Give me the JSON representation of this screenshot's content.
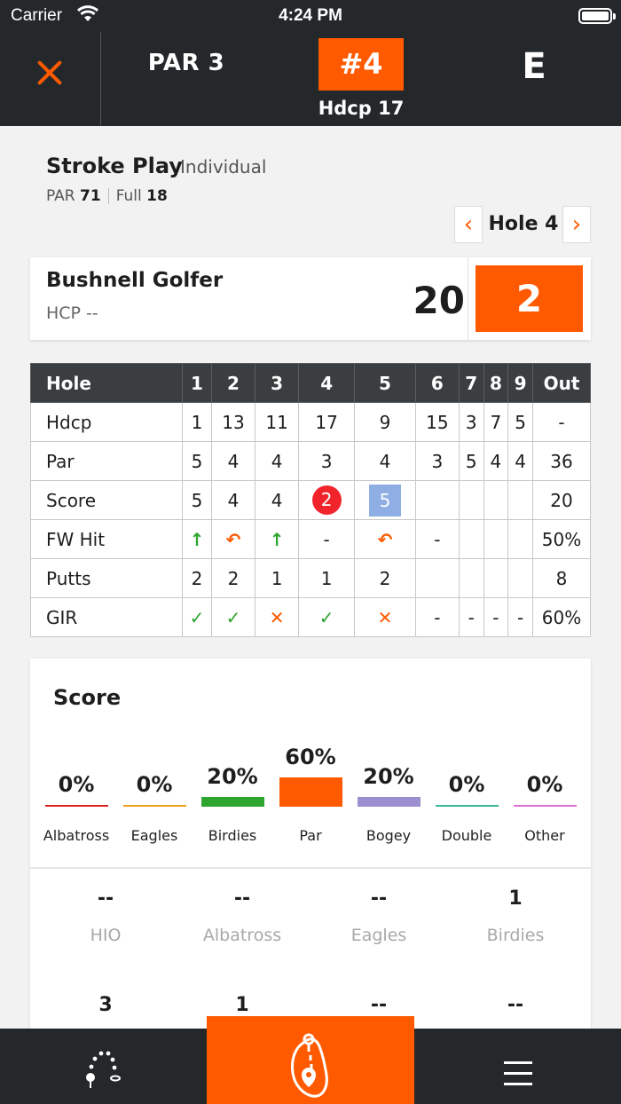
{
  "status_bar": {
    "carrier": "Carrier",
    "time": "4:24 PM"
  },
  "header": {
    "par": "PAR 3",
    "hole": "#4",
    "hdcp": "Hdcp 17",
    "to_par": "E"
  },
  "game": {
    "title": "Stroke Play",
    "subtitle": "Individual",
    "par_label": "PAR",
    "par_value": "71",
    "full_label": "Full",
    "full_value": "18"
  },
  "hole_nav": {
    "label": "Hole 4",
    "prev": "‹",
    "next": "›"
  },
  "player": {
    "name": "Bushnell Golfer",
    "hcp": "HCP --",
    "total": "20",
    "hole_strokes": "2"
  },
  "scorecard": {
    "header": [
      "Hole",
      "1",
      "2",
      "3",
      "4",
      "5",
      "6",
      "7",
      "8",
      "9",
      "Out"
    ],
    "rows": [
      {
        "label": "Hdcp",
        "cells": [
          "1",
          "13",
          "11",
          "17",
          "9",
          "15",
          "3",
          "7",
          "5"
        ],
        "out": "-"
      },
      {
        "label": "Par",
        "cells": [
          "5",
          "4",
          "4",
          "3",
          "4",
          "3",
          "5",
          "4",
          "4"
        ],
        "out": "36"
      },
      {
        "label": "Score",
        "cells": [
          "5",
          "4",
          "4",
          "2",
          "5",
          "",
          "",
          "",
          ""
        ],
        "out": "20"
      },
      {
        "label": "FW Hit",
        "cells": [
          "↑",
          "↶",
          "↑",
          "-",
          "↶",
          "-",
          "",
          "",
          ""
        ],
        "out": "50%"
      },
      {
        "label": "Putts",
        "cells": [
          "2",
          "2",
          "1",
          "1",
          "2",
          "",
          "",
          "",
          ""
        ],
        "out": "8"
      },
      {
        "label": "GIR",
        "cells": [
          "✓",
          "✓",
          "✕",
          "✓",
          "✕",
          "-",
          "-",
          "-",
          "-"
        ],
        "out": "60%"
      }
    ]
  },
  "stats": {
    "title": "Score",
    "distribution": [
      {
        "label": "Albatross",
        "pct": "0%",
        "value": 0,
        "color": "#e02020"
      },
      {
        "label": "Eagles",
        "pct": "0%",
        "value": 0,
        "color": "#f0a020"
      },
      {
        "label": "Birdies",
        "pct": "20%",
        "value": 20,
        "color": "#2ea52e"
      },
      {
        "label": "Par",
        "pct": "60%",
        "value": 60,
        "color": "#ff5a00"
      },
      {
        "label": "Bogey",
        "pct": "20%",
        "value": 20,
        "color": "#9b8fd0"
      },
      {
        "label": "Double",
        "pct": "0%",
        "value": 0,
        "color": "#3bb59b"
      },
      {
        "label": "Other",
        "pct": "0%",
        "value": 0,
        "color": "#e070d0"
      }
    ],
    "counts_row1": [
      {
        "value": "--",
        "name": "HIO"
      },
      {
        "value": "--",
        "name": "Albatross"
      },
      {
        "value": "--",
        "name": "Eagles"
      },
      {
        "value": "1",
        "name": "Birdies"
      }
    ],
    "counts_row2": [
      {
        "value": "3"
      },
      {
        "value": "1"
      },
      {
        "value": "--"
      },
      {
        "value": "--"
      }
    ]
  },
  "colors": {
    "accent": "#ff5a00",
    "dark": "#24282b"
  }
}
